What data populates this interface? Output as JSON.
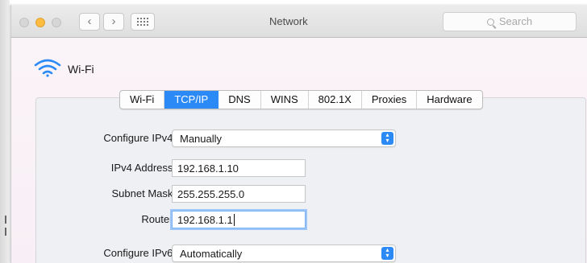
{
  "window": {
    "title": "Network",
    "search_placeholder": "Search",
    "nav_back": "‹",
    "nav_forward": "›"
  },
  "service": {
    "name": "Wi-Fi"
  },
  "tabs": [
    {
      "label": "Wi-Fi"
    },
    {
      "label": "TCP/IP",
      "active": true
    },
    {
      "label": "DNS"
    },
    {
      "label": "WINS"
    },
    {
      "label": "802.1X"
    },
    {
      "label": "Proxies"
    },
    {
      "label": "Hardware"
    }
  ],
  "ipv4": {
    "configure_label": "Configure IPv4:",
    "configure_value": "Manually",
    "address_label": "IPv4 Address:",
    "address_value": "192.168.1.10",
    "subnet_label": "Subnet Mask:",
    "subnet_value": "255.255.255.0",
    "router_label": "Router:",
    "router_value": "192.168.1.1"
  },
  "ipv6": {
    "configure_label": "Configure IPv6:",
    "configure_value": "Automatically"
  },
  "colors": {
    "accent": "#2b8af6",
    "close": "#fc605c",
    "minimize": "#fdbc40",
    "zoom_inactive": "#d6d6d6"
  },
  "icons": {
    "wifi": "wifi-icon",
    "grid": "grid-icon",
    "search": "search-icon",
    "popup_arrows": "up-down-arrows-icon"
  }
}
